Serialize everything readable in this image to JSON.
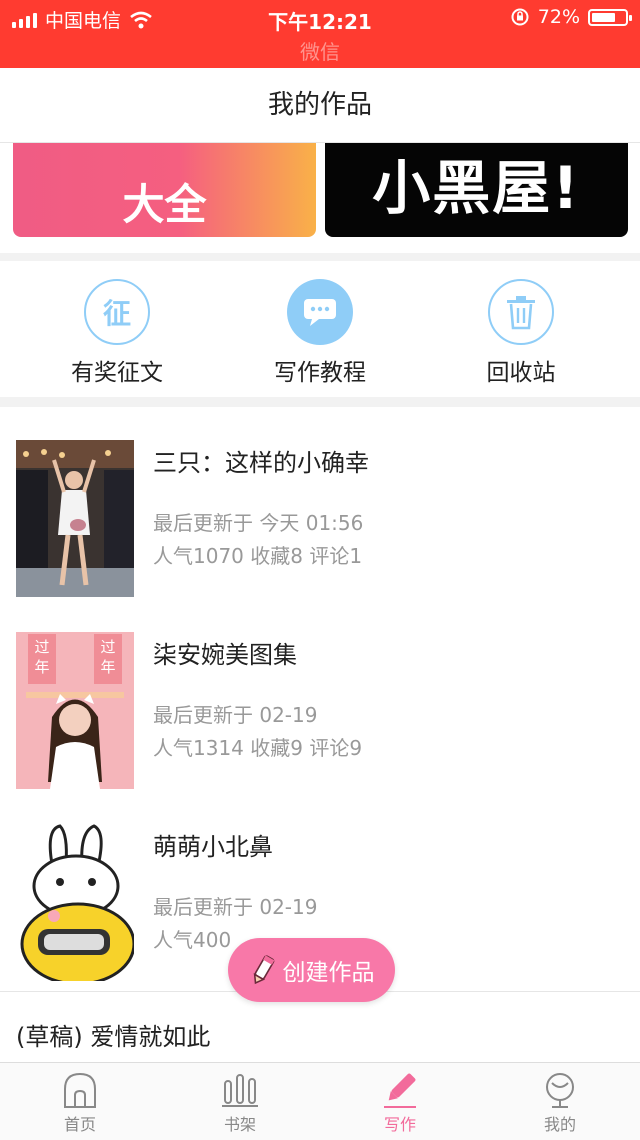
{
  "status_bar": {
    "carrier": "中国电信",
    "time": "下午12:21",
    "battery": "72%",
    "battery_level": 0.72,
    "back_app": "微信"
  },
  "header": {
    "title": "我的作品"
  },
  "banners": [
    {
      "text": "大全"
    },
    {
      "text": "小黑屋!"
    }
  ],
  "actions": [
    {
      "label": "有奖征文",
      "icon": "contest-icon",
      "glyph": "征"
    },
    {
      "label": "写作教程",
      "icon": "chat-bubble-icon"
    },
    {
      "label": "回收站",
      "icon": "trash-icon"
    }
  ],
  "works": [
    {
      "title": "三只：这样的小确幸",
      "updated": "最后更新于 今天 01:56",
      "stats": "人气1070 收藏8 评论1"
    },
    {
      "title": "柒安婉美图集",
      "updated": "最后更新于 02-19",
      "stats": "人气1314 收藏9 评论9",
      "poster_text": [
        "过",
        "年",
        "过",
        "年"
      ]
    },
    {
      "title": "萌萌小北鼻",
      "updated": "最后更新于 02-19",
      "stats": "人气400"
    }
  ],
  "draft": {
    "title": "(草稿) 爱情就如此"
  },
  "fab": {
    "label": "创建作品"
  },
  "tabs": [
    {
      "label": "首页",
      "icon": "home-icon",
      "active": false
    },
    {
      "label": "书架",
      "icon": "bookshelf-icon",
      "active": false
    },
    {
      "label": "写作",
      "icon": "pencil-icon",
      "active": true
    },
    {
      "label": "我的",
      "icon": "profile-icon",
      "active": false
    }
  ],
  "colors": {
    "status_bar": "#ff3b30",
    "accent_pink": "#f26b9b",
    "fab": "#f878a8",
    "action_blue": "#8fcdf7"
  }
}
